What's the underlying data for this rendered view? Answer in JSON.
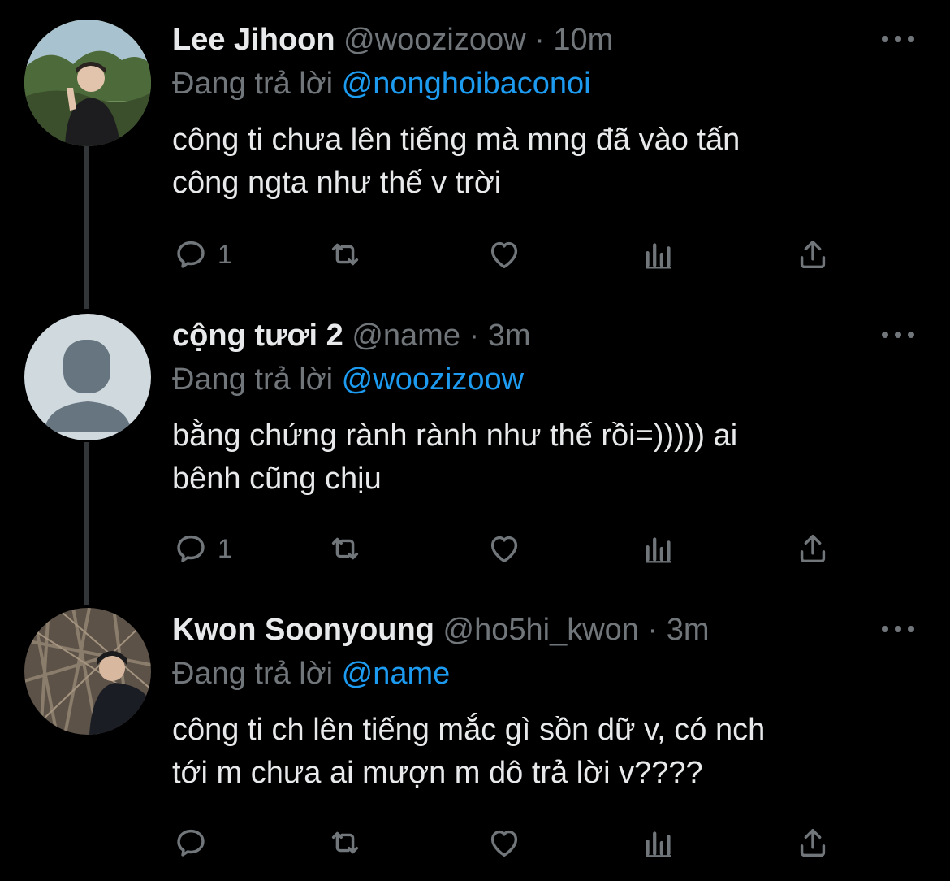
{
  "reply_label": "Đang trả lời",
  "tweets": [
    {
      "name": "Lee Jihoon",
      "handle": "@woozizoow",
      "dot": "·",
      "time": "10m",
      "reply_to": "@nonghoibaconoi",
      "text_line1": "công ti chưa lên tiếng mà mng đã vào tấn",
      "text_line2": "công ngta như thế v trời",
      "reply_count": "1",
      "avatar": "photo-person-outdoors"
    },
    {
      "name": "cộng tươi 2",
      "handle": "@name",
      "dot": "·",
      "time": "3m",
      "reply_to": "@woozizoow",
      "text_line1": "bằng chứng rành rành như thế rồi=))))) ai",
      "text_line2": "bênh cũng chịu",
      "reply_count": "1",
      "avatar": "default-avatar"
    },
    {
      "name": "Kwon Soonyoung",
      "handle": "@ho5hi_kwon",
      "dot": "·",
      "time": "3m",
      "reply_to": "@name",
      "text_line1": "công ti ch lên tiếng mắc gì sồn dữ v, có nch",
      "text_line2": "tới m chưa ai mượn m dô trả lời v????",
      "reply_count": "",
      "avatar": "photo-person-forest"
    }
  ],
  "colors": {
    "background": "#000000",
    "text": "#e7e9ea",
    "secondary": "#71767b",
    "link": "#1d9bf0",
    "thread_line": "#333639"
  },
  "icons": [
    "reply-icon",
    "retweet-icon",
    "like-icon",
    "analytics-icon",
    "share-icon",
    "more-icon"
  ]
}
